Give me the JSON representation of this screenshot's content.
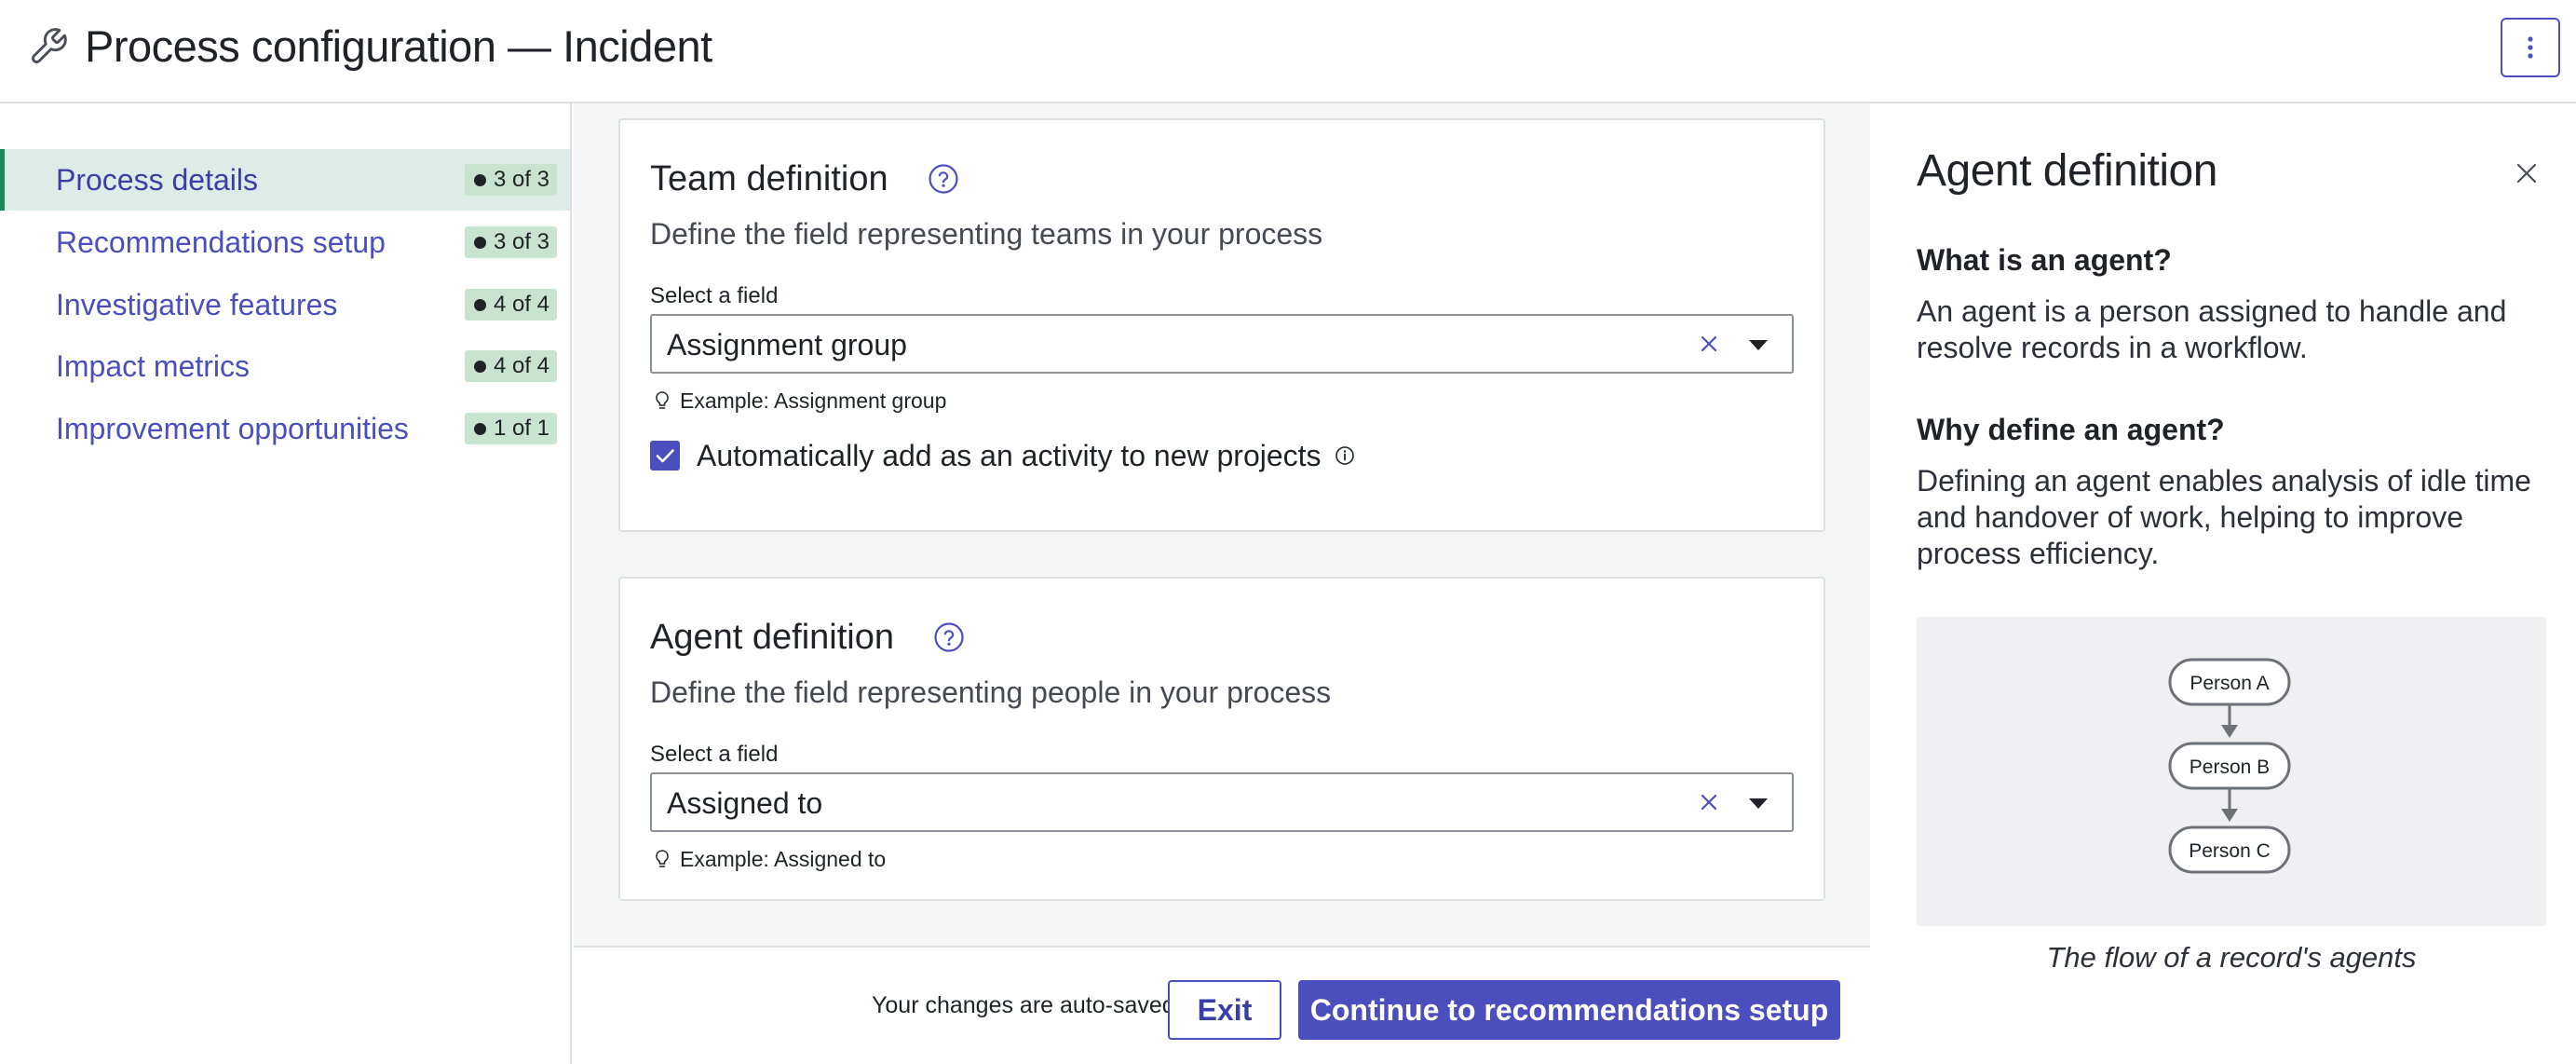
{
  "header": {
    "title": "Process configuration — Incident",
    "icon": "wrench-icon",
    "more_icon": "more-vertical-icon"
  },
  "sidebar": {
    "items": [
      {
        "label": "Process details",
        "badge": "3 of 3",
        "active": true
      },
      {
        "label": "Recommendations setup",
        "badge": "3 of 3",
        "active": false
      },
      {
        "label": "Investigative features",
        "badge": "4 of 4",
        "active": false
      },
      {
        "label": "Impact metrics",
        "badge": "4 of 4",
        "active": false
      },
      {
        "label": "Improvement opportunities",
        "badge": "1 of 1",
        "active": false
      }
    ]
  },
  "team_card": {
    "title": "Team definition",
    "description": "Define the field representing teams in your process",
    "field_label": "Select a field",
    "value": "Assignment group",
    "hint": "Example: Assignment group",
    "checkbox_label": "Automatically add as an activity to new projects",
    "checkbox_checked": true
  },
  "agent_card": {
    "title": "Agent definition",
    "description": "Define the field representing people in your process",
    "field_label": "Select a field",
    "value": "Assigned to",
    "hint": "Example: Assigned to"
  },
  "footer": {
    "autosave": "Your changes are auto-saved",
    "exit_label": "Exit",
    "continue_label": "Continue to recommendations setup"
  },
  "panel": {
    "title": "Agent definition",
    "q1": "What is an agent?",
    "a1": "An agent is a person assigned to handle and resolve records in a workflow.",
    "q2": "Why define an agent?",
    "a2": "Defining an agent enables analysis of idle time and handover of work, helping to improve process efficiency.",
    "diagram_nodes": [
      "Person A",
      "Person B",
      "Person C"
    ],
    "caption": "The flow of a record's agents"
  },
  "colors": {
    "accent": "#4a4fbd",
    "active_bg": "#dcece6",
    "active_border": "#1d8a5c",
    "badge_bg": "#c8e3cf"
  }
}
